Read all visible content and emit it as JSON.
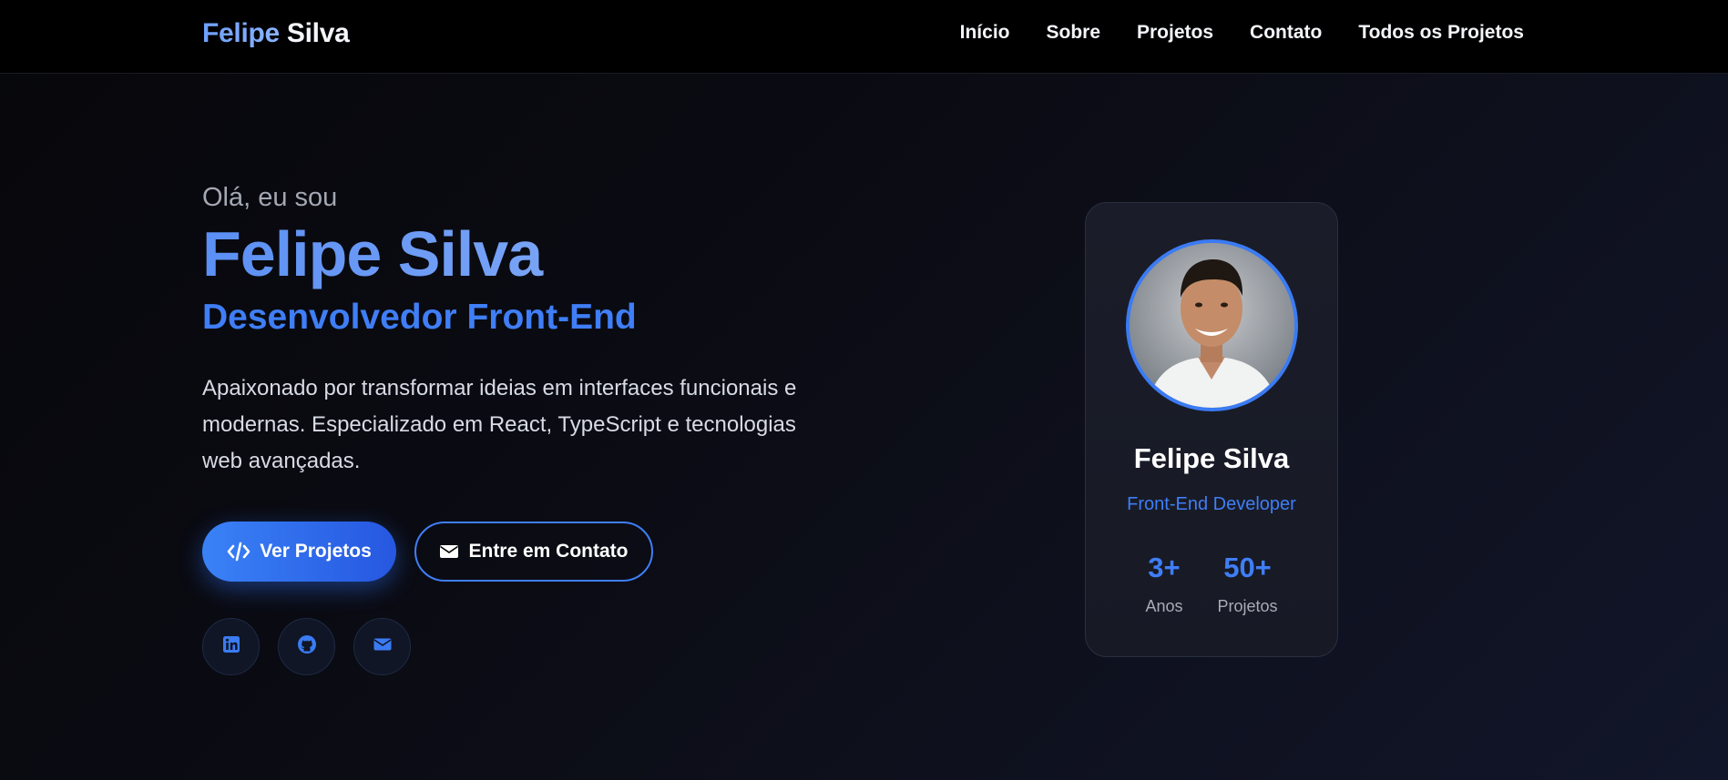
{
  "nav": {
    "brand_first": "Felipe",
    "brand_last": " Silva",
    "links": [
      "Início",
      "Sobre",
      "Projetos",
      "Contato",
      "Todos os Projetos"
    ]
  },
  "hero": {
    "greeting": "Olá, eu sou",
    "name": "Felipe Silva",
    "role": "Desenvolvedor Front-End",
    "description": "Apaixonado por transformar ideias em interfaces funcionais e modernas. Especializado em React, TypeScript e tecnologias web avançadas.",
    "primary_button": {
      "label": "Ver Projetos",
      "icon": "code-icon"
    },
    "secondary_button": {
      "label": "Entre em Contato",
      "icon": "envelope-icon"
    },
    "social": [
      {
        "icon": "linkedin-icon"
      },
      {
        "icon": "github-icon"
      },
      {
        "icon": "envelope-icon"
      }
    ]
  },
  "profile_card": {
    "name": "Felipe Silva",
    "role": "Front-End Developer",
    "stats": [
      {
        "value": "3+",
        "label": "Anos"
      },
      {
        "value": "50+",
        "label": "Projetos"
      }
    ]
  },
  "colors": {
    "accent": "#3f7ef6",
    "background": "#0a0b10",
    "nav_background": "#000000",
    "card_background": "#1a1d29"
  }
}
